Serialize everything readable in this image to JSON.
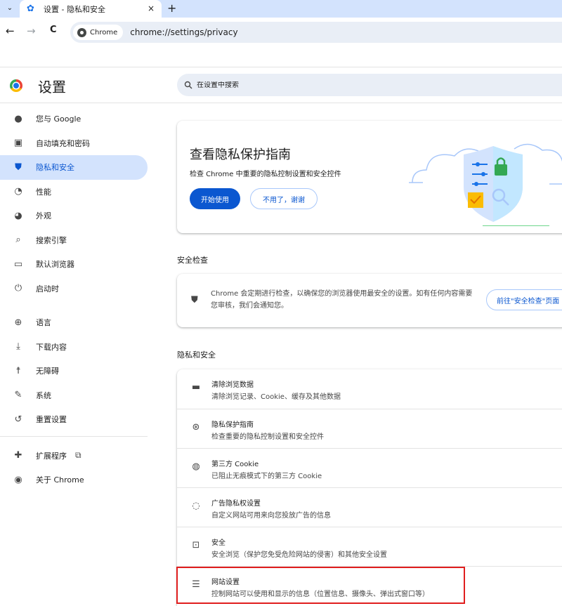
{
  "tab": {
    "title": "设置 - 隐私和安全",
    "close": "×",
    "newtab": "+"
  },
  "toolbar": {
    "back": "←",
    "forward": "→",
    "reload": "C",
    "chip_label": "Chrome",
    "url": "chrome://settings/privacy"
  },
  "header": {
    "title": "设置",
    "search_placeholder": "在设置中搜索"
  },
  "sidebar": {
    "items": [
      {
        "label": "您与 Google",
        "icon": "person-icon"
      },
      {
        "label": "自动填充和密码",
        "icon": "clipboard-icon"
      },
      {
        "label": "隐私和安全",
        "icon": "shield-icon",
        "active": true
      },
      {
        "label": "性能",
        "icon": "speedometer-icon"
      },
      {
        "label": "外观",
        "icon": "palette-icon"
      },
      {
        "label": "搜索引擎",
        "icon": "search-icon"
      },
      {
        "label": "默认浏览器",
        "icon": "browser-icon"
      },
      {
        "label": "启动时",
        "icon": "power-icon"
      },
      {
        "label": "语言",
        "icon": "globe-icon"
      },
      {
        "label": "下载内容",
        "icon": "download-icon"
      },
      {
        "label": "无障碍",
        "icon": "accessibility-icon"
      },
      {
        "label": "系统",
        "icon": "wrench-icon"
      },
      {
        "label": "重置设置",
        "icon": "reset-icon"
      },
      {
        "label": "扩展程序",
        "icon": "puzzle-icon"
      },
      {
        "label": "关于 Chrome",
        "icon": "chrome-icon"
      }
    ]
  },
  "guide": {
    "title": "查看隐私保护指南",
    "subtitle": "检查 Chrome 中重要的隐私控制设置和安全控件",
    "start": "开始使用",
    "dismiss": "不用了，谢谢"
  },
  "safety": {
    "section_title": "安全检查",
    "text": "Chrome 会定期进行检查，以确保您的浏览器使用最安全的设置。如有任何内容需要您审核，我们会通知您。",
    "button": "前往\"安全检查\"页面"
  },
  "privacy": {
    "section_title": "隐私和安全",
    "rows": [
      {
        "title": "清除浏览数据",
        "sub": "清除浏览记录、Cookie、缓存及其他数据",
        "icon": "trash-icon"
      },
      {
        "title": "隐私保护指南",
        "sub": "检查重要的隐私控制设置和安全控件",
        "icon": "compass-icon"
      },
      {
        "title": "第三方 Cookie",
        "sub": "已阻止无痕模式下的第三方 Cookie",
        "icon": "cookie-icon"
      },
      {
        "title": "广告隐私权设置",
        "sub": "自定义网站可用来向您投放广告的信息",
        "icon": "ad-privacy-icon"
      },
      {
        "title": "安全",
        "sub": "安全浏览（保护您免受危险网站的侵害）和其他安全设置",
        "icon": "lock-icon"
      },
      {
        "title": "网站设置",
        "sub": "控制网站可以使用和显示的信息（位置信息、摄像头、弹出式窗口等）",
        "icon": "sliders-icon"
      }
    ]
  },
  "colors": {
    "accent": "#0b57d0",
    "active_bg": "#d3e3fd",
    "highlight": "#e01e1e"
  }
}
